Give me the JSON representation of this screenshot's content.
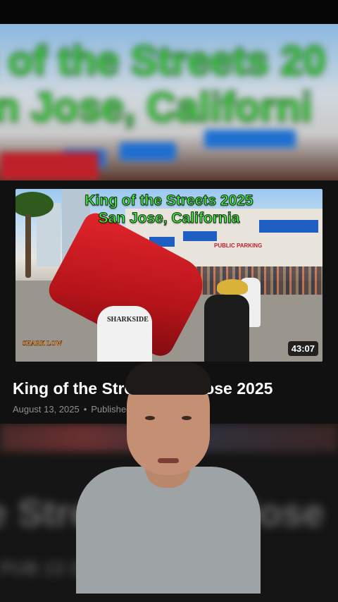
{
  "backdrop": {
    "title_line1": "g of the Streets 20",
    "title_line2": "an Jose, Californi"
  },
  "video_card": {
    "thumbnail": {
      "overlay_line1": "King of the Streets 2025",
      "overlay_line2": "San Jose, California",
      "sign_text": "PUBLIC PARKING",
      "shirt_text": "SHARKSIDE",
      "channel_logo_text": "SHARK LOW",
      "duration": "43:07"
    },
    "title": "King of the Streets San Jose 2025",
    "date": "August 13, 2025",
    "separator": "•",
    "published_label": "Published"
  },
  "lower_backdrop": {
    "big_text": "e Streets San Jose",
    "small_text": "PUB 13 2025"
  },
  "colors": {
    "background": "#0b0b0b",
    "overlay_text_green": "#49f04a",
    "title_text": "#ffffff",
    "meta_text": "#8e8e8e"
  }
}
